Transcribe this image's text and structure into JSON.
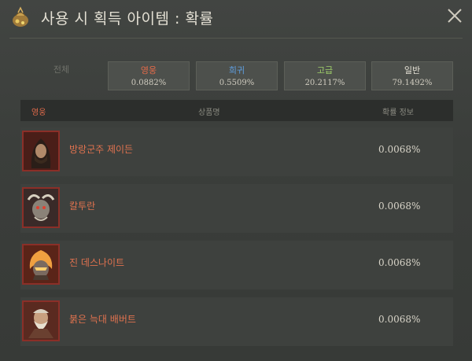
{
  "header": {
    "title": "사용 시 획득 아이템 : 확률",
    "icon": "treasure-pouch-icon",
    "close_icon": "close-icon"
  },
  "tabs": [
    {
      "label": "전체",
      "value": "",
      "color": "#6f716a"
    },
    {
      "label": "영웅",
      "value": "0.0882%",
      "color": "#e06a4a"
    },
    {
      "label": "희귀",
      "value": "0.5509%",
      "color": "#5f9fe0"
    },
    {
      "label": "고급",
      "value": "20.2117%",
      "color": "#9fcf6a"
    },
    {
      "label": "일반",
      "value": "79.1492%",
      "color": "#e4e0d4"
    }
  ],
  "table": {
    "headers": {
      "grade": "영웅",
      "name": "상품명",
      "prob": "확률 정보"
    },
    "rows": [
      {
        "name": "방랑군주 제이든",
        "prob": "0.0068%",
        "icon": "hooded-man-portrait-icon"
      },
      {
        "name": "칼투란",
        "prob": "0.0068%",
        "icon": "horned-creature-portrait-icon"
      },
      {
        "name": "진 데스나이트",
        "prob": "0.0068%",
        "icon": "flaming-knight-portrait-icon"
      },
      {
        "name": "붉은 늑대 배버트",
        "prob": "0.0068%",
        "icon": "bearded-warrior-portrait-icon"
      }
    ]
  },
  "colors": {
    "hero": "#e06a4a",
    "rare": "#5f9fe0",
    "advanced": "#9fcf6a",
    "frame": "#8b2f28"
  }
}
